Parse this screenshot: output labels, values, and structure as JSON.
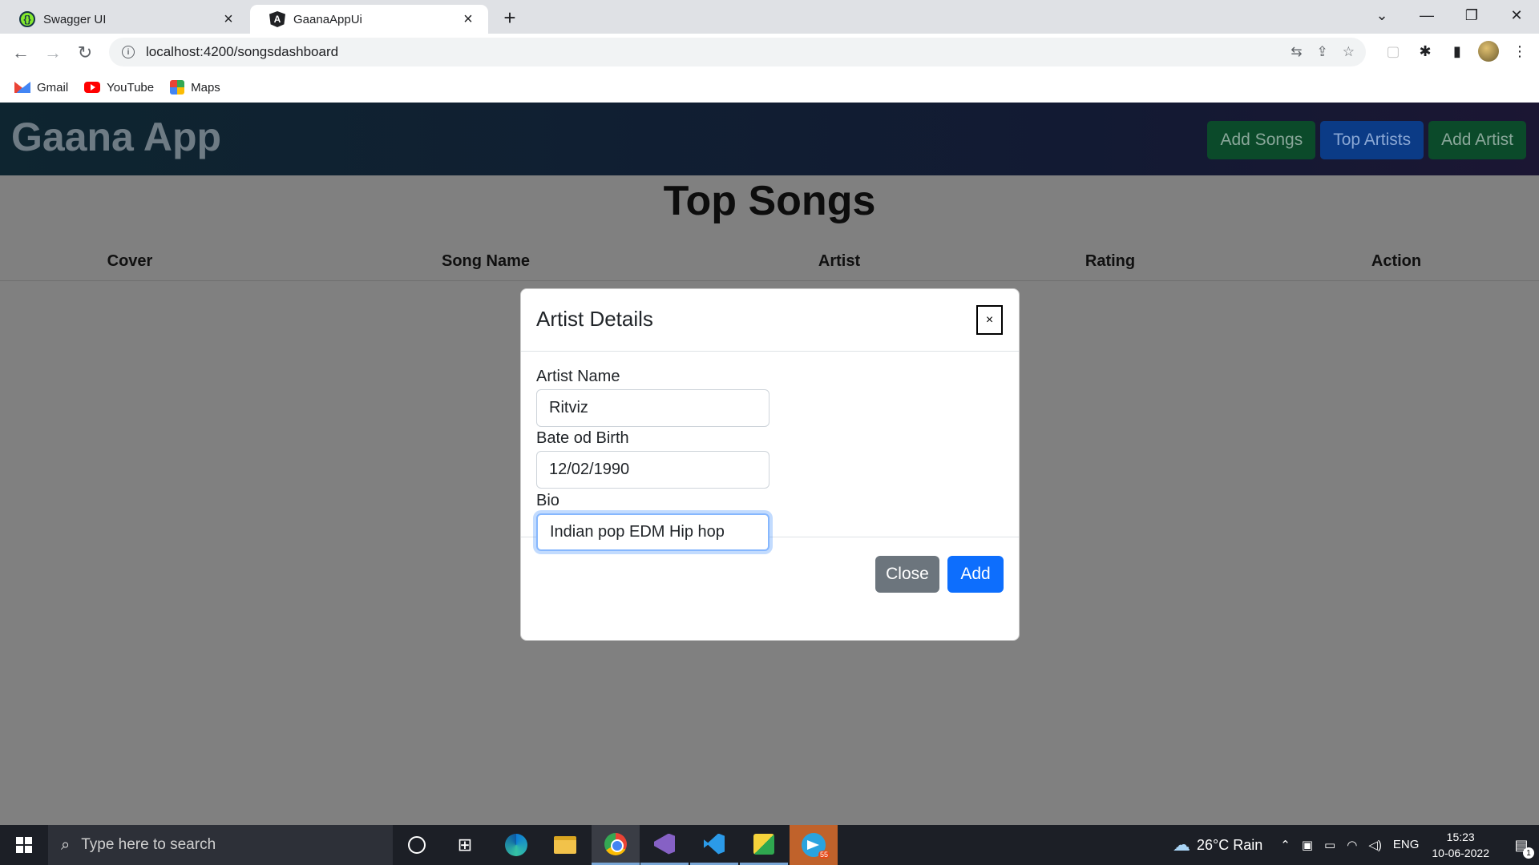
{
  "browser": {
    "tabs": [
      {
        "title": "Swagger UI",
        "active": false
      },
      {
        "title": "GaanaAppUi",
        "active": true
      }
    ],
    "new_tab_label": "+",
    "url": "localhost:4200/songsdashboard",
    "bookmarks": [
      {
        "label": "Gmail",
        "icon": "gmail-icon"
      },
      {
        "label": "YouTube",
        "icon": "youtube-icon"
      },
      {
        "label": "Maps",
        "icon": "maps-icon"
      }
    ]
  },
  "app": {
    "brand": "Gaana App",
    "nav_buttons": {
      "add_songs": "Add Songs",
      "top_artists": "Top Artists",
      "add_artist": "Add Artist"
    },
    "page_title": "Top Songs",
    "table_headers": [
      "Cover",
      "Song Name",
      "Artist",
      "Rating",
      "Action"
    ]
  },
  "modal": {
    "title": "Artist Details",
    "close_symbol": "×",
    "fields": [
      {
        "label": "Artist Name",
        "value": "Ritviz"
      },
      {
        "label": "Bate od Birth",
        "value": "12/02/1990"
      },
      {
        "label": "Bio",
        "value": "Indian pop EDM Hip hop"
      }
    ],
    "buttons": {
      "close": "Close",
      "add": "Add"
    }
  },
  "taskbar": {
    "search_placeholder": "Type here to search",
    "weather": "26°C  Rain",
    "language": "ENG",
    "time": "15:23",
    "date": "10-06-2022",
    "notification_count": "1",
    "telegram_badge": "55"
  },
  "colors": {
    "backdrop": "#808080",
    "primary": "#0d6efd",
    "secondary": "#6c757d",
    "success": "#198754"
  }
}
